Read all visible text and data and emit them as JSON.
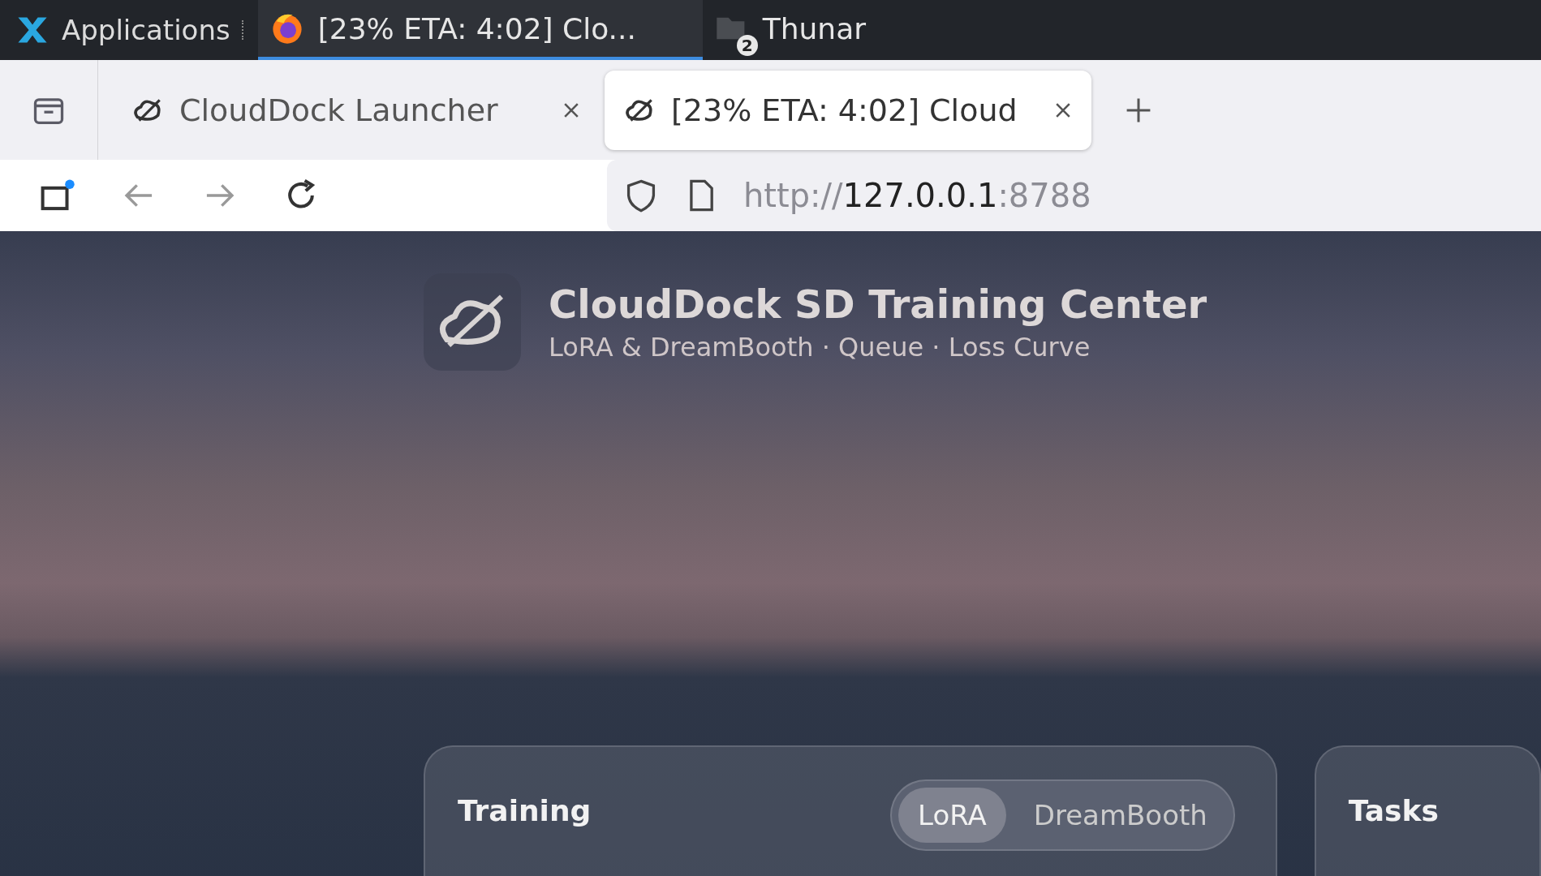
{
  "taskbar": {
    "menu_label": "Applications",
    "tasks": [
      {
        "kind": "browser",
        "label": "[23% ETA: 4:02] Clo...",
        "selected": true
      },
      {
        "kind": "folder",
        "label": "Thunar",
        "badge": "2",
        "selected": false
      }
    ]
  },
  "browser": {
    "tabs": [
      {
        "title": "CloudDock Launcher",
        "selected": false
      },
      {
        "title": "[23% ETA: 4:02] Cloud",
        "selected": true
      }
    ],
    "url": {
      "scheme": "http://",
      "host": "127.0.0.1",
      "port": ":8788"
    }
  },
  "page": {
    "title": "CloudDock SD Training Center",
    "subtitle": "LoRA & DreamBooth · Queue · Loss Curve",
    "training_card": {
      "title": "Training",
      "modes": [
        {
          "label": "LoRA",
          "selected": true
        },
        {
          "label": "DreamBooth",
          "selected": false
        }
      ]
    },
    "tasks_card": {
      "title": "Tasks"
    }
  }
}
